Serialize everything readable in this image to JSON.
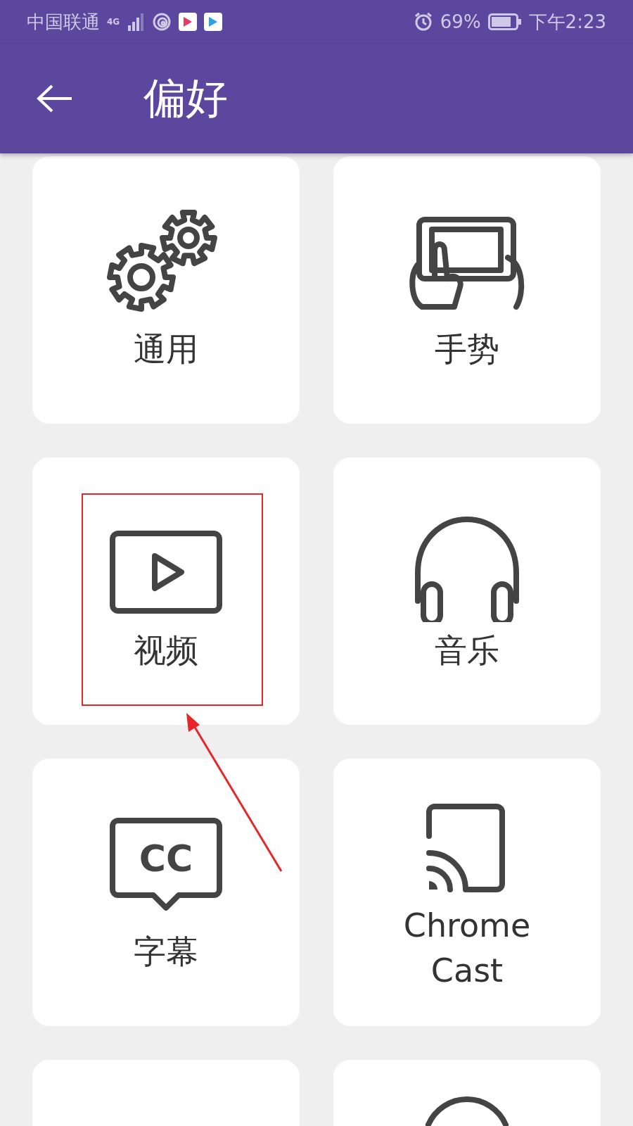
{
  "status_bar": {
    "carrier": "中国联通",
    "network": "4G",
    "battery": "69%",
    "time": "下午2:23"
  },
  "app_bar": {
    "title": "偏好"
  },
  "cards": [
    {
      "label": "通用",
      "kind": "gears"
    },
    {
      "label": "手势",
      "kind": "gesture"
    },
    {
      "label": "视频",
      "kind": "play"
    },
    {
      "label": "音乐",
      "kind": "headphones"
    },
    {
      "label": "字幕",
      "kind": "cc",
      "icon_text": "CC"
    },
    {
      "label": "Chrome Cast",
      "kind": "cast"
    },
    {
      "kind": "blank"
    },
    {
      "kind": "arc"
    }
  ]
}
